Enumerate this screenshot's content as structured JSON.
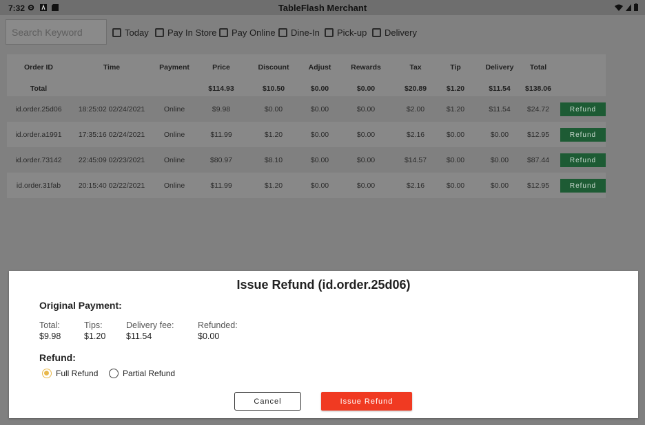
{
  "status_bar": {
    "time": "7:32",
    "icons": [
      "gear-icon",
      "a-icon",
      "sd-card-icon"
    ],
    "right_icons": [
      "wifi-icon",
      "signal-icon",
      "battery-icon"
    ]
  },
  "app": {
    "title": "TableFlash Merchant"
  },
  "search": {
    "placeholder": "Search Keyword"
  },
  "filters": [
    "Today",
    "Pay In Store",
    "Pay Online",
    "Dine-In",
    "Pick-up",
    "Delivery"
  ],
  "table": {
    "headers": [
      "Order ID",
      "Time",
      "Payment",
      "Price",
      "Discount",
      "Adjust",
      "Rewards",
      "Tax",
      "Tip",
      "Delivery",
      "Total"
    ],
    "total_row": [
      "Total",
      "",
      "",
      "$114.93",
      "$10.50",
      "$0.00",
      "$0.00",
      "$20.89",
      "$1.20",
      "$11.54",
      "$138.06"
    ],
    "rows": [
      [
        "id.order.25d06",
        "18:25:02 02/24/2021",
        "Online",
        "$9.98",
        "$0.00",
        "$0.00",
        "$0.00",
        "$2.00",
        "$1.20",
        "$11.54",
        "$24.72"
      ],
      [
        "id.order.a1991",
        "17:35:16 02/24/2021",
        "Online",
        "$11.99",
        "$1.20",
        "$0.00",
        "$0.00",
        "$2.16",
        "$0.00",
        "$0.00",
        "$12.95"
      ],
      [
        "id.order.73142",
        "22:45:09 02/23/2021",
        "Online",
        "$80.97",
        "$8.10",
        "$0.00",
        "$0.00",
        "$14.57",
        "$0.00",
        "$0.00",
        "$87.44"
      ],
      [
        "id.order.31fab",
        "20:15:40 02/22/2021",
        "Online",
        "$11.99",
        "$1.20",
        "$0.00",
        "$0.00",
        "$2.16",
        "$0.00",
        "$0.00",
        "$12.95"
      ]
    ],
    "refund_label": "Refund"
  },
  "dialog": {
    "title": "Issue Refund (id.order.25d06)",
    "original_payment_label": "Original Payment:",
    "total_label": "Total:",
    "total_value": "$9.98",
    "tips_label": "Tips:",
    "tips_value": "$1.20",
    "delivery_label": "Delivery fee:",
    "delivery_value": "$11.54",
    "refunded_label": "Refunded:",
    "refunded_value": "$0.00",
    "refund_label": "Refund:",
    "full_refund": "Full Refund",
    "partial_refund": "Partial Refund",
    "selected": "Full Refund",
    "cancel": "Cancel",
    "issue": "Issue Refund"
  },
  "colors": {
    "accent_refund": "#1d5b34",
    "issue_button": "#f03a22",
    "radio_selected": "#e8b84c"
  }
}
